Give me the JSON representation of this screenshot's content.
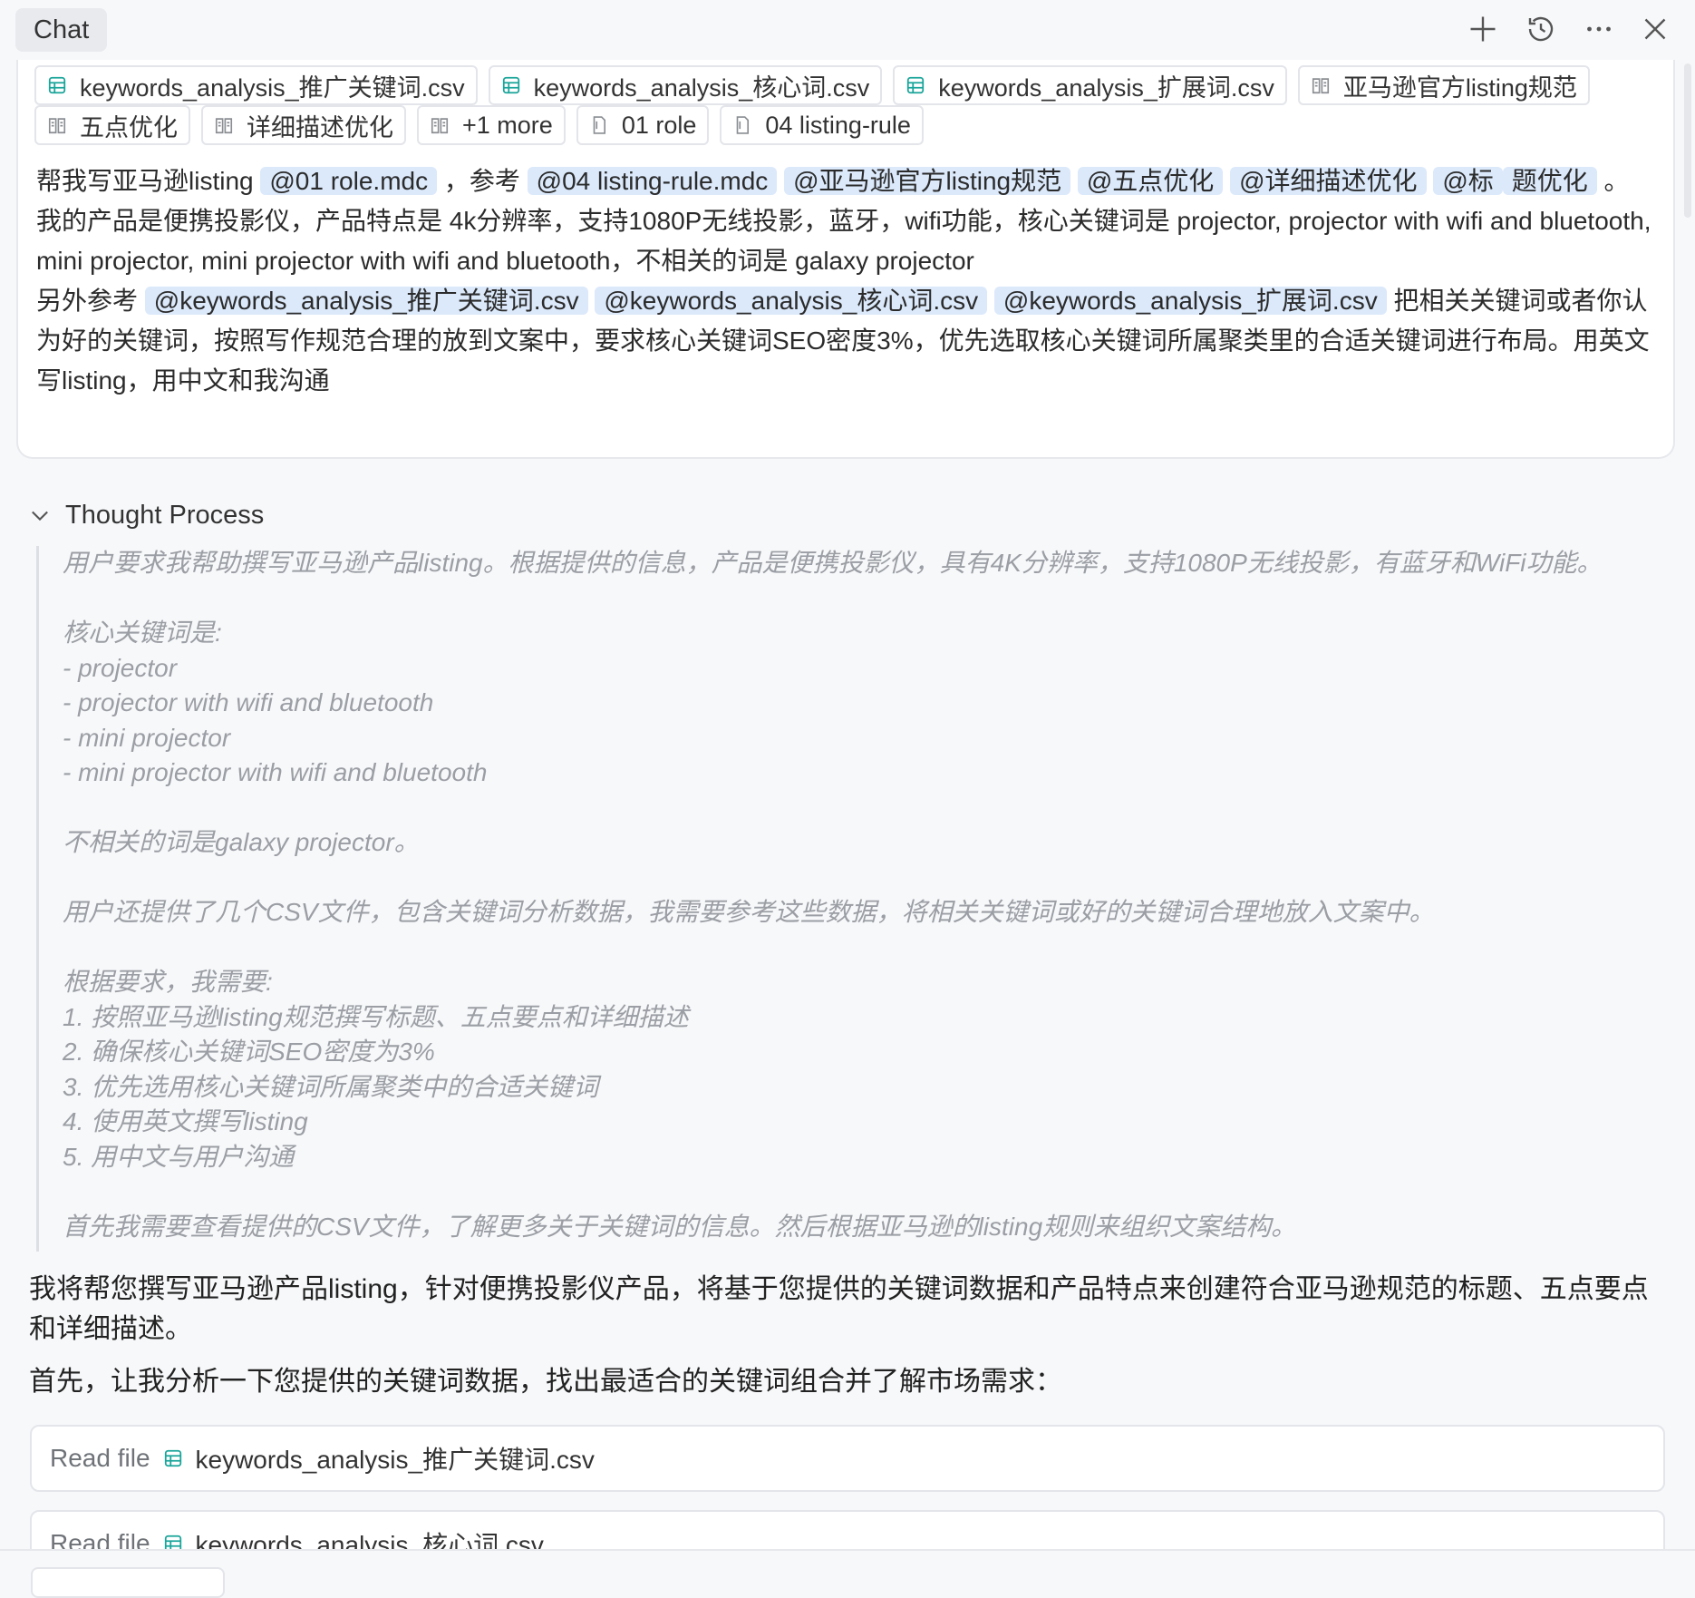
{
  "header": {
    "tab_label": "Chat"
  },
  "attachments_row1": [
    {
      "label": "keywords_analysis_推广关键词.csv",
      "type": "csv"
    },
    {
      "label": "keywords_analysis_核心词.csv",
      "type": "csv"
    },
    {
      "label": "keywords_analysis_扩展词.csv",
      "type": "csv"
    },
    {
      "label": "亚马逊官方listing规范",
      "type": "doc"
    }
  ],
  "attachments_row2": [
    {
      "label": "五点优化",
      "type": "doc"
    },
    {
      "label": "详细描述优化",
      "type": "doc"
    },
    {
      "label": "+1 more",
      "type": "doc"
    },
    {
      "label": "01 role",
      "type": "file"
    },
    {
      "label": "04 listing-rule",
      "type": "file"
    }
  ],
  "user_message": {
    "p1_a": "帮我写亚马逊listing",
    "m_role": "@01 role.mdc",
    "p1_b": "，参考",
    "m_rule": "@04 listing-rule.mdc",
    "m_official": "@亚马逊官方listing规范",
    "m_five": "@五点优化",
    "m_detail": "@详细描述优化",
    "m_title_a": "@标",
    "m_title_b": "题优化",
    "p1_end": "。",
    "p2": "我的产品是便携投影仪，产品特点是 4k分辨率，支持1080P无线投影，蓝牙，wifi功能，核心关键词是 projector, projector with wifi and bluetooth, mini projector, mini projector with wifi and bluetooth，不相关的词是 galaxy projector",
    "p3_a": "另外参考",
    "m_csv1": "@keywords_analysis_推广关键词.csv",
    "m_csv2": "@keywords_analysis_核心词.csv",
    "m_csv3": "@keywords_analysis_扩展词.csv",
    "p3_b": "把相关关键词或者你认为好的关键词，按照写作规范合理的放到文案中，要求核心关键词SEO密度3%，优先选取核心关键词所属聚类里的合适关键词进行布局。用英文写listing，用中文和我沟通"
  },
  "thought": {
    "heading": "Thought Process",
    "lines": [
      "用户要求我帮助撰写亚马逊产品listing。根据提供的信息，产品是便携投影仪，具有4K分辨率，支持1080P无线投影，有蓝牙和WiFi功能。",
      "",
      "核心关键词是:",
      "- projector",
      "- projector with wifi and bluetooth",
      "- mini projector",
      "- mini projector with wifi and bluetooth",
      "",
      "不相关的词是galaxy projector。",
      "",
      "用户还提供了几个CSV文件，包含关键词分析数据，我需要参考这些数据，将相关关键词或好的关键词合理地放入文案中。",
      "",
      "根据要求，我需要:",
      "1. 按照亚马逊listing规范撰写标题、五点要点和详细描述",
      "2. 确保核心关键词SEO密度为3%",
      "3. 优先选用核心关键词所属聚类中的合适关键词",
      "4. 使用英文撰写listing",
      "5. 用中文与用户沟通",
      "",
      "首先我需要查看提供的CSV文件，了解更多关于关键词的信息。然后根据亚马逊的listing规则来组织文案结构。"
    ]
  },
  "reply": {
    "p1": "我将帮您撰写亚马逊产品listing，针对便携投影仪产品，将基于您提供的关键词数据和产品特点来创建符合亚马逊规范的标题、五点要点和详细描述。",
    "p2": "首先，让我分析一下您提供的关键词数据，找出最适合的关键词组合并了解市场需求："
  },
  "tool_calls": [
    {
      "label": "Read file",
      "file": "keywords_analysis_推广关键词.csv"
    },
    {
      "label": "Read file",
      "file": "keywords_analysis_核心词.csv"
    }
  ],
  "colors": {
    "csv_icon": "#1aa59a",
    "mention_bg": "#dbe9fb",
    "thought_text": "#9b9ea4"
  }
}
